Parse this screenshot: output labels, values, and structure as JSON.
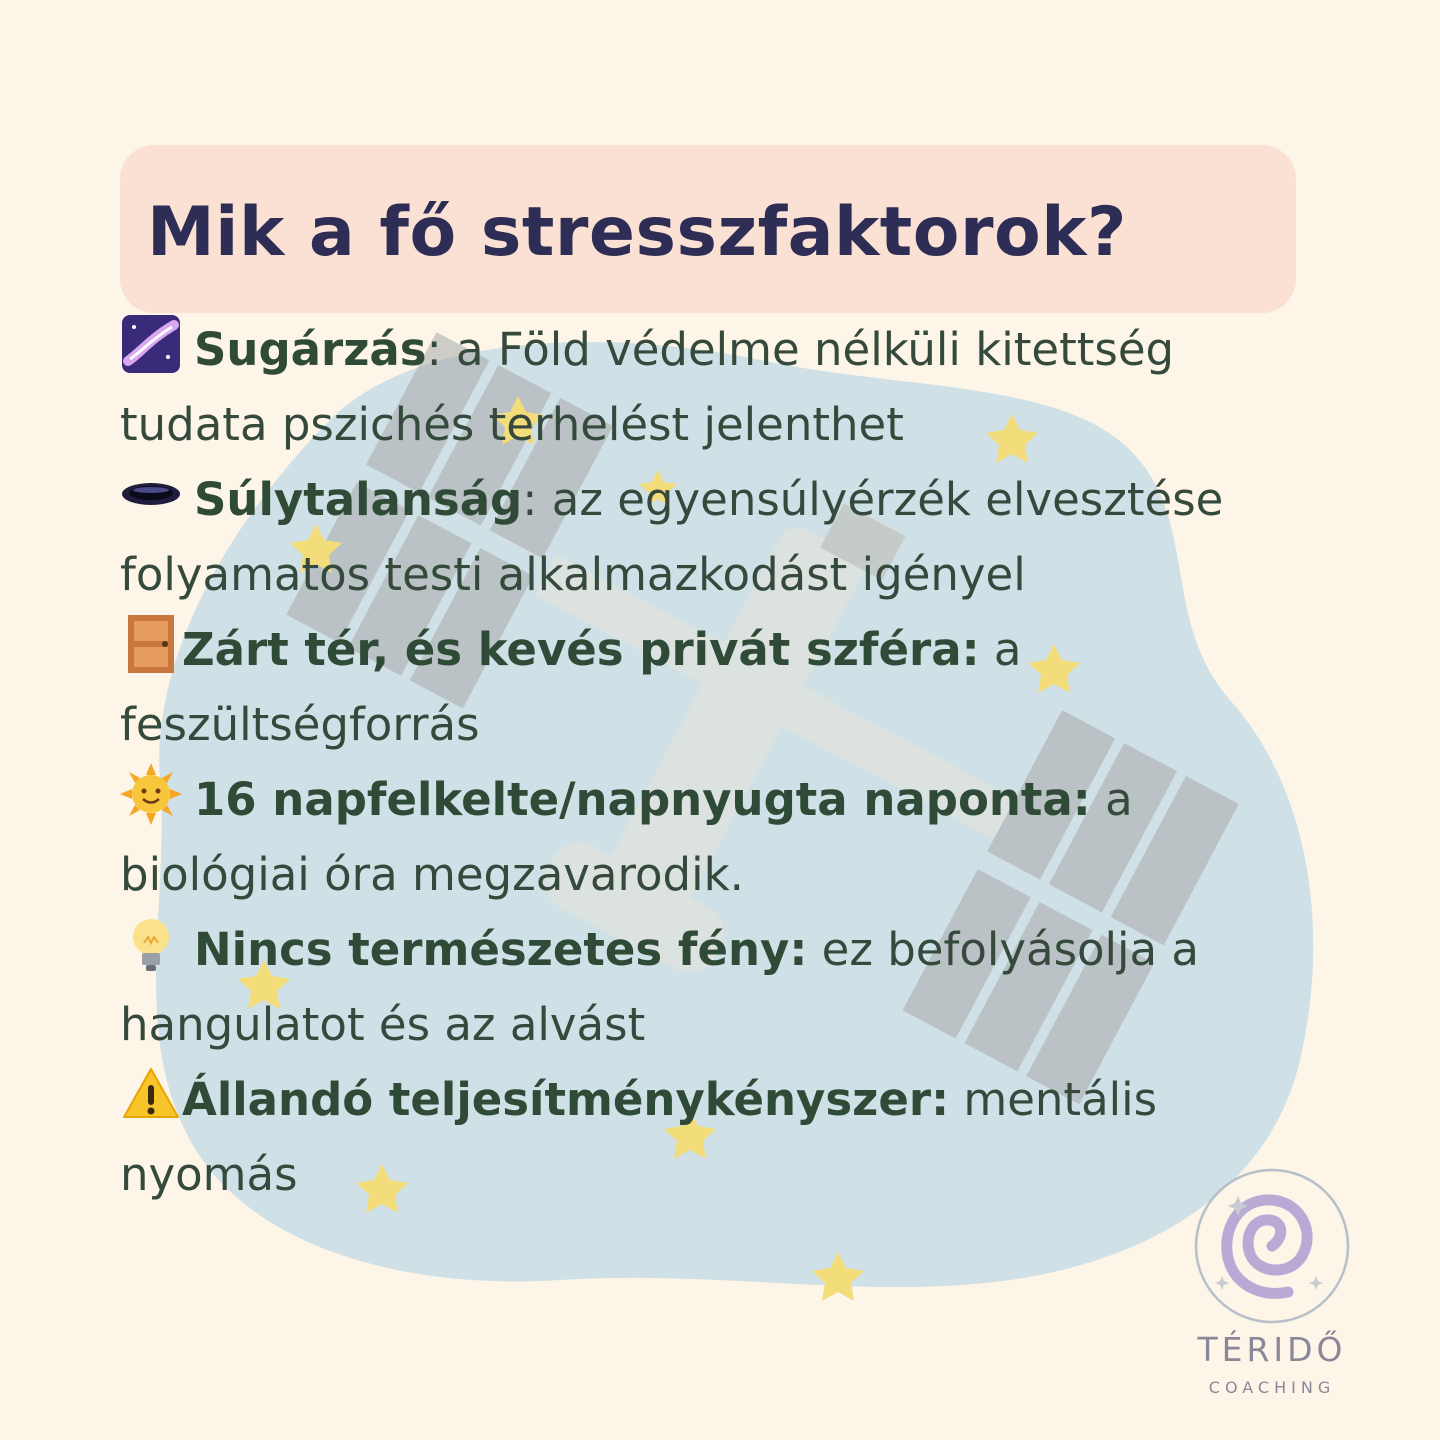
{
  "title": "Mik a fő stresszfaktorok?",
  "items": [
    {
      "icon": "milky-way-icon",
      "label": "Sugárzás",
      "text": ": a Föld védelme nélküli kitettség tudata pszichés terhelést jelenthet"
    },
    {
      "icon": "hole-icon",
      "label": "Súlytalanság",
      "text": ": az egyensúlyérzék elvesztése folyamatos testi alkalmazkodást igényel"
    },
    {
      "icon": "door-icon",
      "label": "Zárt tér, és kevés privát szféra:",
      "text": " a feszültségforrás"
    },
    {
      "icon": "sun-with-face-icon",
      "label": "16 napfelkelte/napnyugta naponta:",
      "text": " a biológiai óra megzavarodik."
    },
    {
      "icon": "light-bulb-icon",
      "label": "Nincs természetes fény:",
      "text": " ez befolyásolja a hangulatot és az alvást"
    },
    {
      "icon": "warning-icon",
      "label": "Állandó teljesítménykényszer:",
      "text": " mentális nyomás"
    }
  ],
  "brand": {
    "name": "TÉRIDŐ",
    "sub": "COACHING"
  },
  "colors": {
    "background": "#fcf5e8",
    "title_box": "#fbe1d3",
    "title_text": "#2e2d55",
    "body_text": "#354a3c",
    "blob": "#cfe0e6"
  }
}
